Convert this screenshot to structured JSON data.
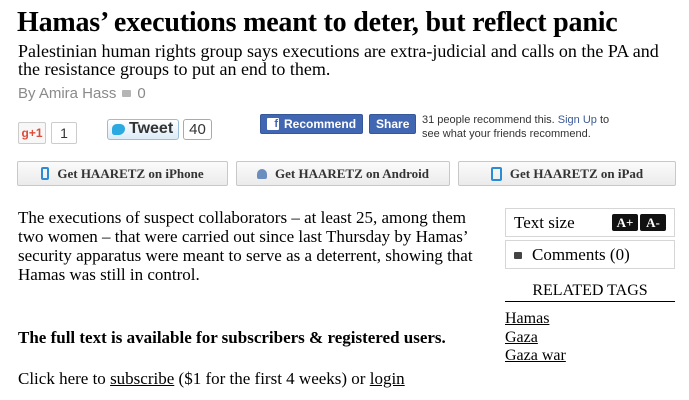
{
  "article": {
    "title": "Hamas’ executions meant to deter, but reflect panic",
    "subtitle": "Palestinian human rights group says executions are extra-judicial and calls on the PA and the resistance groups to put an end to them.",
    "byline": "By Amira Hass",
    "comment_count": "0",
    "body": "The executions of suspect collaborators – at least 25, among them two women – that were carried out since last Thursday by Hamas’ security apparatus were meant to serve as a deterrent, showing that Hamas was still in control.",
    "paywall_text": "The full text is available for subscribers & registered users.",
    "subscribe_prefix": "Click here to",
    "subscribe_link": "subscribe",
    "subscribe_middle": "($1 for the first 4 weeks) or",
    "login_link": "login"
  },
  "social": {
    "gplus_label": "g+1",
    "gplus_count": "1",
    "tweet_label": "Tweet",
    "tweet_count": "40",
    "fb_recommend": "Recommend",
    "fb_share": "Share",
    "fb_text_prefix": "31 people recommend this.",
    "fb_signup": "Sign Up",
    "fb_text_suffix": "to see what your friends recommend."
  },
  "apps": {
    "iphone": "Get HAARETZ on iPhone",
    "android": "Get HAARETZ on Android",
    "ipad": "Get HAARETZ on iPad"
  },
  "sidebar": {
    "text_size_label": "Text size",
    "increase": "A+",
    "decrease": "A-",
    "comments_label": "Comments (0)",
    "related_title": "RELATED TAGS",
    "tags": [
      "Hamas",
      "Gaza",
      "Gaza war"
    ]
  },
  "colors": {
    "facebook": "#4267b2",
    "twitter": "#2ba9e1",
    "gplus": "#dd4b39"
  }
}
